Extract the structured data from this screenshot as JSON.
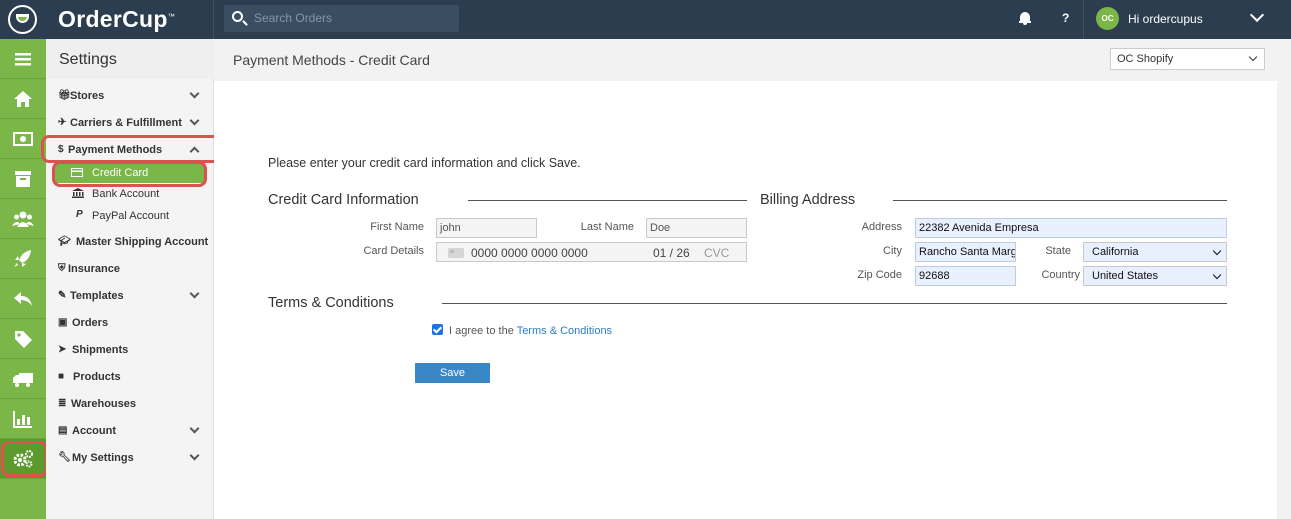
{
  "app": {
    "brand": "OrderCup",
    "brand_tm": "™"
  },
  "topbar": {
    "search_placeholder": "Search Orders",
    "help_label": "?",
    "avatar_initials": "OC",
    "greeting": "Hi ordercupus"
  },
  "rail": {
    "items": [
      "menu-icon",
      "home-icon",
      "money-icon",
      "archive-icon",
      "users-icon",
      "rocket-icon",
      "reply-icon",
      "tag-icon",
      "truck-icon",
      "bar-chart-icon",
      "cogs-icon"
    ],
    "active": "cogs-icon"
  },
  "sidebar": {
    "title": "Settings",
    "items": [
      {
        "label": "Stores",
        "icon": "gift-icon",
        "expandable": true
      },
      {
        "label": "Carriers & Fulfillment",
        "icon": "plane-icon",
        "expandable": true
      },
      {
        "label": "Payment Methods",
        "icon": "dollar-icon",
        "expandable": true,
        "expanded": true
      },
      {
        "label": "Master Shipping Account",
        "icon": "graduation-cap-icon"
      },
      {
        "label": "Insurance",
        "icon": "shield-icon"
      },
      {
        "label": "Templates",
        "icon": "edit-icon",
        "expandable": true
      },
      {
        "label": "Orders",
        "icon": "money-icon"
      },
      {
        "label": "Shipments",
        "icon": "send-icon"
      },
      {
        "label": "Products",
        "icon": "box-icon"
      },
      {
        "label": "Warehouses",
        "icon": "database-icon"
      },
      {
        "label": "Account",
        "icon": "briefcase-icon",
        "expandable": true
      },
      {
        "label": "My Settings",
        "icon": "wrench-icon",
        "expandable": true
      }
    ],
    "payment_sub": [
      {
        "label": "Credit Card",
        "icon": "credit-card-icon",
        "active": true
      },
      {
        "label": "Bank Account",
        "icon": "bank-icon"
      },
      {
        "label": "PayPal Account",
        "icon": "paypal-icon"
      }
    ]
  },
  "header": {
    "title": "Payment Methods - Credit Card",
    "store_selected": "OC Shopify"
  },
  "form": {
    "intro": "Please enter your credit card information and click Save.",
    "cc_section": "Credit Card Information",
    "billing_section": "Billing Address",
    "terms_section": "Terms & Conditions",
    "first_name_label": "First Name",
    "first_name": "john",
    "last_name_label": "Last Name",
    "last_name": "Doe",
    "card_details_label": "Card Details",
    "card_number": "0000 0000 0000 0000",
    "card_expiry": "01 / 26",
    "card_cvc_placeholder": "CVC",
    "address_label": "Address",
    "address": "22382 Avenida Empresa",
    "city_label": "City",
    "city": "Rancho Santa Marg",
    "state_label": "State",
    "state": "California",
    "zip_label": "Zip Code",
    "zip": "92688",
    "country_label": "Country",
    "country": "United States",
    "agree_prefix": "I agree to the ",
    "agree_link": "Terms & Conditions",
    "agree_checked": true,
    "save_label": "Save"
  },
  "colors": {
    "topbar": "#2b3d4f",
    "accent_green": "#7ab648",
    "button_blue": "#3a87c8",
    "callout_red": "#d9534f"
  }
}
